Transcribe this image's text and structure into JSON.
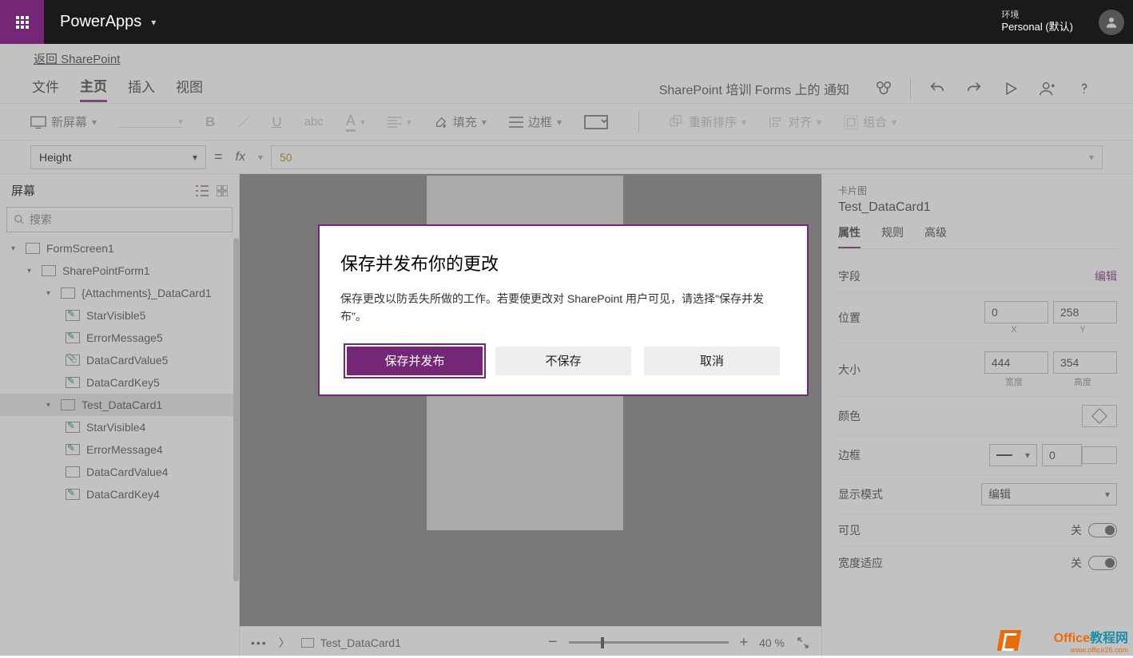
{
  "header": {
    "app_name": "PowerApps",
    "env_label": "环境",
    "env_value": "Personal (默认)"
  },
  "backlink": "返回 SharePoint",
  "tabs": {
    "file": "文件",
    "home": "主页",
    "insert": "插入",
    "view": "视图"
  },
  "status_text": "SharePoint 培训 Forms 上的 通知",
  "toolbar": {
    "newscreen": "新屏幕",
    "fill": "填充",
    "border": "边框",
    "reorder": "重新排序",
    "align": "对齐",
    "group": "组合"
  },
  "formula": {
    "property": "Height",
    "value": "50"
  },
  "tree": {
    "panel_label": "屏幕",
    "search_placeholder": "搜索",
    "nodes": {
      "formscreen": "FormScreen1",
      "form": "SharePointForm1",
      "attach": "{Attachments}_DataCard1",
      "sv5": "StarVisible5",
      "em5": "ErrorMessage5",
      "dcv5": "DataCardValue5",
      "dck5": "DataCardKey5",
      "test": "Test_DataCard1",
      "sv4": "StarVisible4",
      "em4": "ErrorMessage4",
      "dcv4": "DataCardValue4",
      "dck4": "DataCardKey4"
    }
  },
  "canvas_footer": {
    "breadcrumb": "Test_DataCard1",
    "zoom": "40  %"
  },
  "props": {
    "crumb": "卡片图",
    "name": "Test_DataCard1",
    "tabs": {
      "properties": "属性",
      "rules": "规则",
      "advanced": "高级"
    },
    "field_label": "字段",
    "edit": "编辑",
    "pos_label": "位置",
    "pos_x": "0",
    "pos_y": "258",
    "x_lbl": "X",
    "y_lbl": "Y",
    "size_label": "大小",
    "size_w": "444",
    "size_h": "354",
    "w_lbl": "宽度",
    "h_lbl": "高度",
    "color_label": "颜色",
    "border_label": "边框",
    "border_val": "0",
    "mode_label": "显示模式",
    "mode_val": "编辑",
    "visible_label": "可见",
    "visible_off": "关",
    "widthfit_label": "宽度适应",
    "widthfit_off": "关"
  },
  "dialog": {
    "title": "保存并发布你的更改",
    "body": "保存更改以防丢失所做的工作。若要使更改对 SharePoint 用户可见，请选择\"保存并发布\"。",
    "save_publish": "保存并发布",
    "dont_save": "不保存",
    "cancel": "取消"
  },
  "watermark": {
    "line1": "Office教程网",
    "line2": "www.office26.com"
  }
}
